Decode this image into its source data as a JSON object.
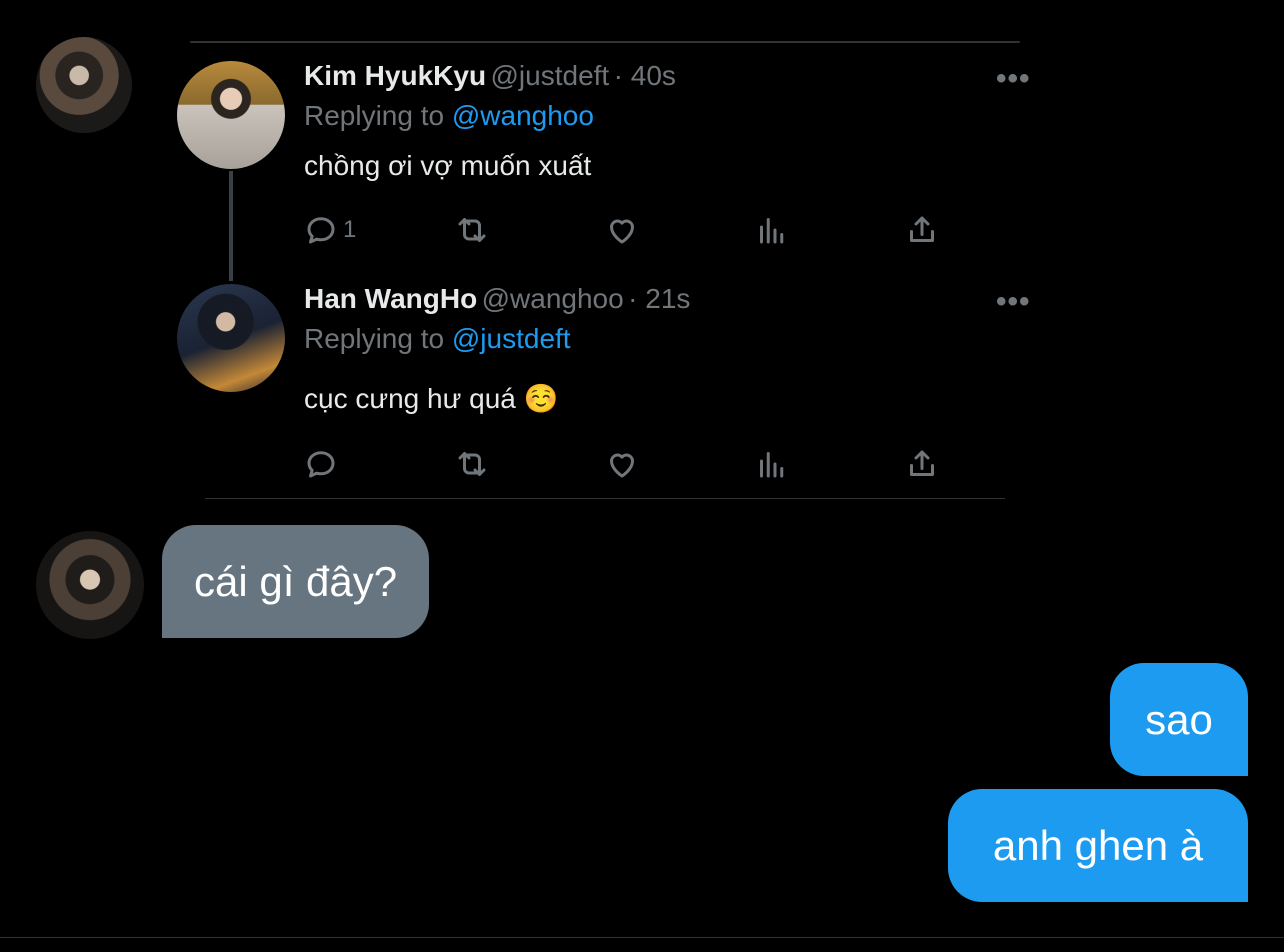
{
  "tweets": [
    {
      "name": "Kim HyukKyu",
      "handle": "@justdeft",
      "time": "· 40s",
      "replying_prefix": "Replying to",
      "replying_to": "@wanghoo",
      "text": "chồng ơi vợ muốn xuất",
      "more": "•••",
      "reply_count": "1"
    },
    {
      "name": "Han WangHo",
      "handle": "@wanghoo",
      "time": "· 21s",
      "replying_prefix": "Replying to",
      "replying_to": "@justdeft",
      "text": "cục cưng hư quá ☺️",
      "more": "•••",
      "reply_count": ""
    }
  ],
  "messages": {
    "incoming": [
      "cái gì đây?"
    ],
    "outgoing": [
      "sao",
      "anh ghen à"
    ]
  },
  "icons": [
    "reply-icon",
    "retweet-icon",
    "like-icon",
    "analytics-icon",
    "share-icon"
  ],
  "colors": {
    "accent": "#1d9bf0",
    "incoming_bubble": "#66757f",
    "muted": "#71767b",
    "background": "#000000"
  }
}
